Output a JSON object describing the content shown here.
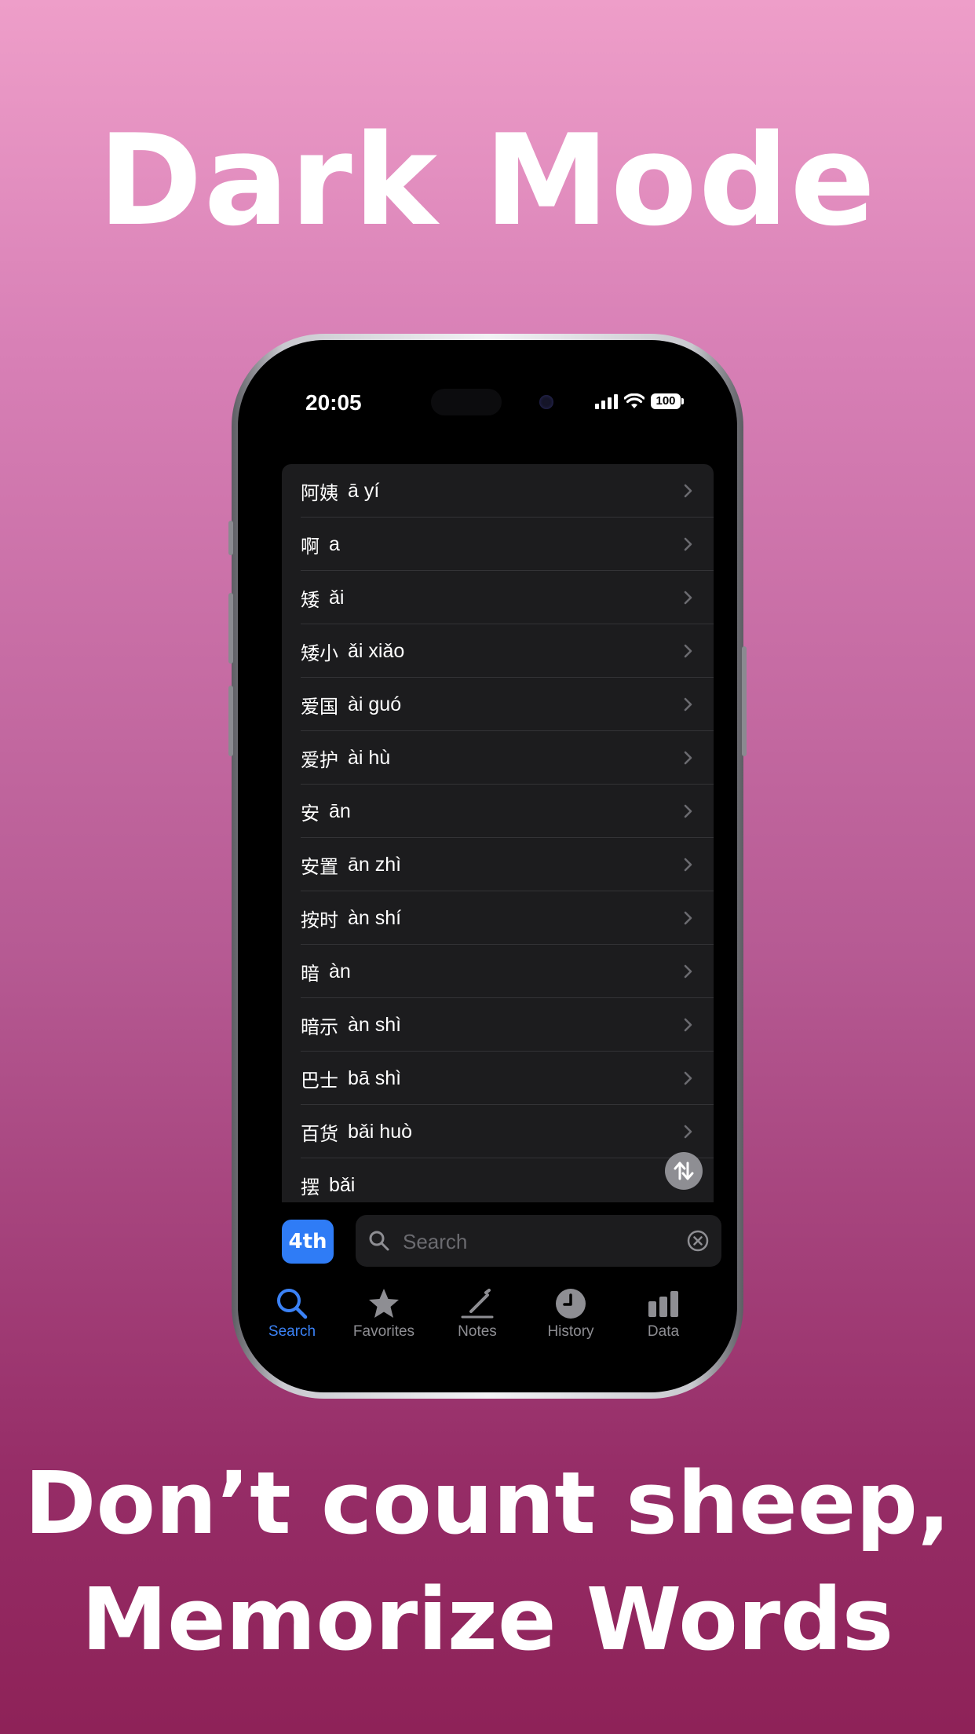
{
  "promo": {
    "headline": "Dark Mode",
    "tagline_line1": "Don’t count sheep,",
    "tagline_line2": "Memorize Words",
    "background_top": "#ee9ec9",
    "background_bottom": "#8e2258"
  },
  "status_bar": {
    "time": "20:05",
    "battery": "100"
  },
  "word_list": [
    {
      "hanzi": "阿姨",
      "pinyin": "ā yí"
    },
    {
      "hanzi": "啊",
      "pinyin": "a"
    },
    {
      "hanzi": "矮",
      "pinyin": "ǎi"
    },
    {
      "hanzi": "矮小",
      "pinyin": "ǎi xiǎo"
    },
    {
      "hanzi": "爱国",
      "pinyin": "ài guó"
    },
    {
      "hanzi": "爱护",
      "pinyin": "ài hù"
    },
    {
      "hanzi": "安",
      "pinyin": "ān"
    },
    {
      "hanzi": "安置",
      "pinyin": "ān zhì"
    },
    {
      "hanzi": "按时",
      "pinyin": "àn shí"
    },
    {
      "hanzi": "暗",
      "pinyin": "àn"
    },
    {
      "hanzi": "暗示",
      "pinyin": "àn shì"
    },
    {
      "hanzi": "巴士",
      "pinyin": "bā shì"
    },
    {
      "hanzi": "百货",
      "pinyin": "bǎi huò"
    },
    {
      "hanzi": "摆",
      "pinyin": "bǎi"
    }
  ],
  "search_bar": {
    "level_label": "4th",
    "placeholder": "Search",
    "value": ""
  },
  "tab_bar": {
    "active_color": "#3b82f6",
    "tabs": [
      {
        "label": "Search",
        "icon": "search-icon",
        "active": true
      },
      {
        "label": "Favorites",
        "icon": "star-icon",
        "active": false
      },
      {
        "label": "Notes",
        "icon": "pencil-icon",
        "active": false
      },
      {
        "label": "History",
        "icon": "clock-icon",
        "active": false
      },
      {
        "label": "Data",
        "icon": "bar-chart-icon",
        "active": false
      }
    ]
  }
}
